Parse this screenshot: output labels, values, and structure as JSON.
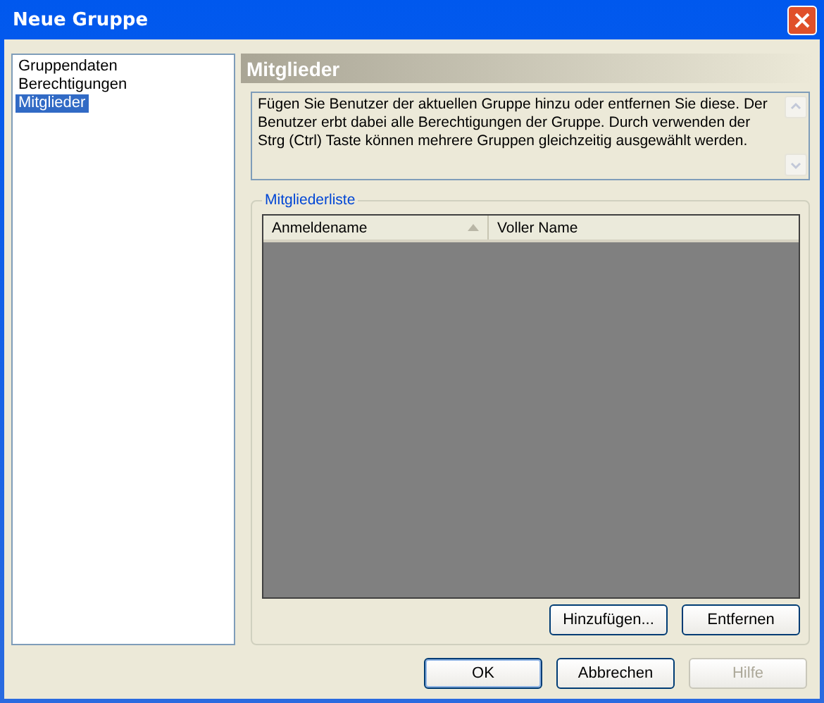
{
  "window": {
    "title": "Neue Gruppe"
  },
  "sidebar": {
    "items": [
      {
        "label": "Gruppendaten",
        "selected": false
      },
      {
        "label": "Berechtigungen",
        "selected": false
      },
      {
        "label": "Mitglieder",
        "selected": true
      }
    ]
  },
  "panel": {
    "title": "Mitglieder",
    "description": "Fügen Sie Benutzer der aktuellen Gruppe hinzu oder entfernen Sie diese. Der Benutzer erbt dabei alle Berechtigungen der Gruppe. Durch verwenden der Strg (Ctrl) Taste können mehrere Gruppen gleichzeitig ausgewählt werden.",
    "group_label": "Mitgliederliste",
    "table": {
      "columns": [
        {
          "label": "Anmeldename",
          "sorted": true
        },
        {
          "label": "Voller Name",
          "sorted": false
        }
      ]
    },
    "list_buttons": [
      {
        "label": "Hinzufügen...",
        "disabled": false
      },
      {
        "label": "Entfernen",
        "disabled": false
      }
    ]
  },
  "buttons": [
    {
      "label": "OK",
      "disabled": false,
      "default": true
    },
    {
      "label": "Abbrechen",
      "disabled": false,
      "default": false
    },
    {
      "label": "Hilfe",
      "disabled": true,
      "default": false
    }
  ]
}
